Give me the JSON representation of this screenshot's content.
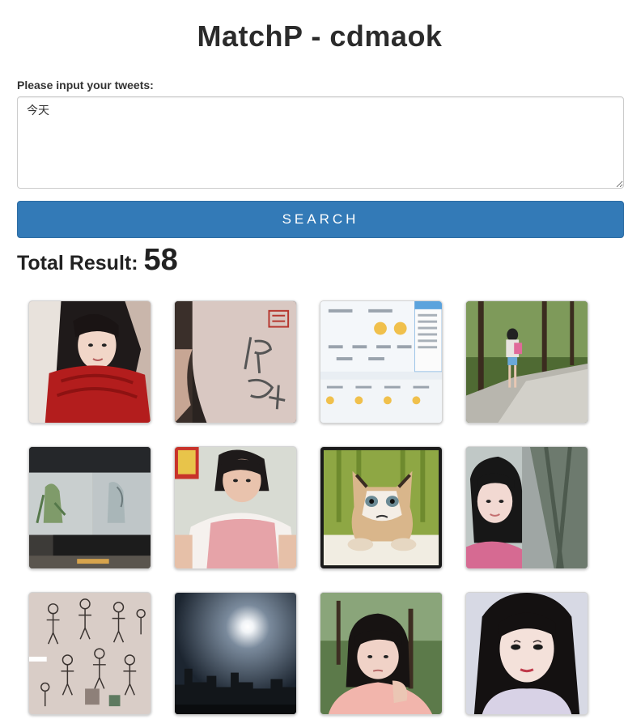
{
  "header": {
    "title": "MatchP - cdmaok"
  },
  "form": {
    "label": "Please input your tweets:",
    "tweet_value": "今天",
    "search_label": "SEARCH"
  },
  "results": {
    "total_label": "Total Result:",
    "total_count": "58",
    "images": [
      {
        "name": "photo-girl-red-scarf"
      },
      {
        "name": "photo-shirt-calligraphy"
      },
      {
        "name": "photo-game-screenshot"
      },
      {
        "name": "photo-girl-forest-path"
      },
      {
        "name": "photo-sketches-desk"
      },
      {
        "name": "photo-girl-pink-dress"
      },
      {
        "name": "photo-grumpy-cat"
      },
      {
        "name": "photo-girl-trees"
      },
      {
        "name": "photo-fashion-sketches"
      },
      {
        "name": "photo-sun-sky-city"
      },
      {
        "name": "photo-girl-chin-hand"
      },
      {
        "name": "photo-girl-portrait"
      }
    ]
  }
}
